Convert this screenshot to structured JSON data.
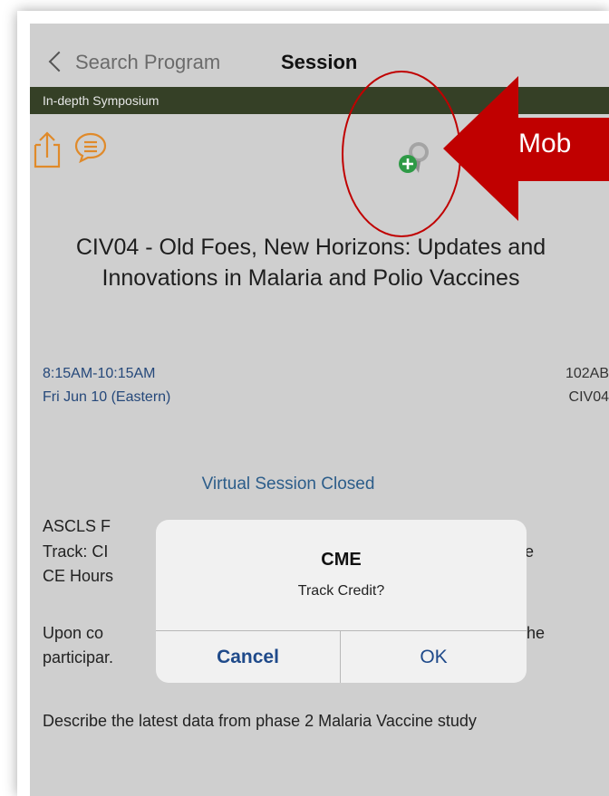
{
  "nav": {
    "back_label": "Search Program",
    "title": "Session"
  },
  "category": "In-depth Symposium",
  "session": {
    "title": "CIV04 - Old Foes, New Horizons: Updates and Innovations in Malaria and Polio Vaccines",
    "time": "8:15AM-10:15AM",
    "date": "Fri Jun 10 (Eastern)",
    "room": "102AB",
    "code": "CIV04",
    "virtual_status": "Virtual Session Closed",
    "line1": "ASCLS F",
    "line2": "Track: CI",
    "line2_tail": "e",
    "line3": "CE Hours",
    "line4": "Upon co",
    "line4_tail": "he",
    "line5": "participar.",
    "description": "Describe the latest data from phase 2 Malaria Vaccine study"
  },
  "dialog": {
    "title": "CME",
    "message": "Track Credit?",
    "cancel_label": "Cancel",
    "ok_label": "OK"
  },
  "annotation": {
    "label": "Mob",
    "arrow_color": "#c00000",
    "circle_color": "#c00000"
  },
  "colors": {
    "category_bar": "#354026",
    "accent_orange": "#e08a2a",
    "link_blue": "#25487a",
    "add_green": "#2e9a46"
  }
}
